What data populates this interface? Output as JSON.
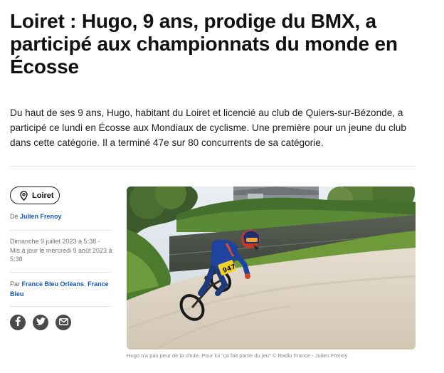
{
  "article": {
    "title": "Loiret : Hugo, 9 ans, prodige du BMX, a participé aux championnats du monde en Écosse",
    "lead": "Du haut de ses 9 ans, Hugo, habitant du Loiret et licencié au club de Quiers-sur-Bézonde, a participé ce lundi en Écosse aux Mondiaux de cyclisme. Une première pour un jeune du club dans cette catégorie. Il a terminé 47e sur 80 concurrents de sa catégorie."
  },
  "meta": {
    "location_tag": "Loiret",
    "location_icon": "map-pin-icon",
    "byline_prefix": "De",
    "author": "Julien Frenoy",
    "published": "Dimanche 9 juillet 2023 à 5:38 -",
    "updated": "Mis à jour le mercredi 9 août 2023 à 5:38",
    "source_prefix": "Par",
    "source_primary": "France Bleu Orléans",
    "source_separator": ",",
    "source_secondary": "France Bleu"
  },
  "share": {
    "buttons": [
      {
        "icon": "facebook-icon"
      },
      {
        "icon": "twitter-icon"
      },
      {
        "icon": "email-icon"
      }
    ]
  },
  "photo": {
    "caption": "Hugo n'a pas peur de la chute. Pour lui \"ça fait partie du jeu\" © Radio France - Julien Frenoy",
    "bib_number": "947"
  },
  "colors": {
    "link": "#1558c0",
    "text": "#111111",
    "muted": "#757575",
    "icon_button": "#4b4b4b"
  }
}
